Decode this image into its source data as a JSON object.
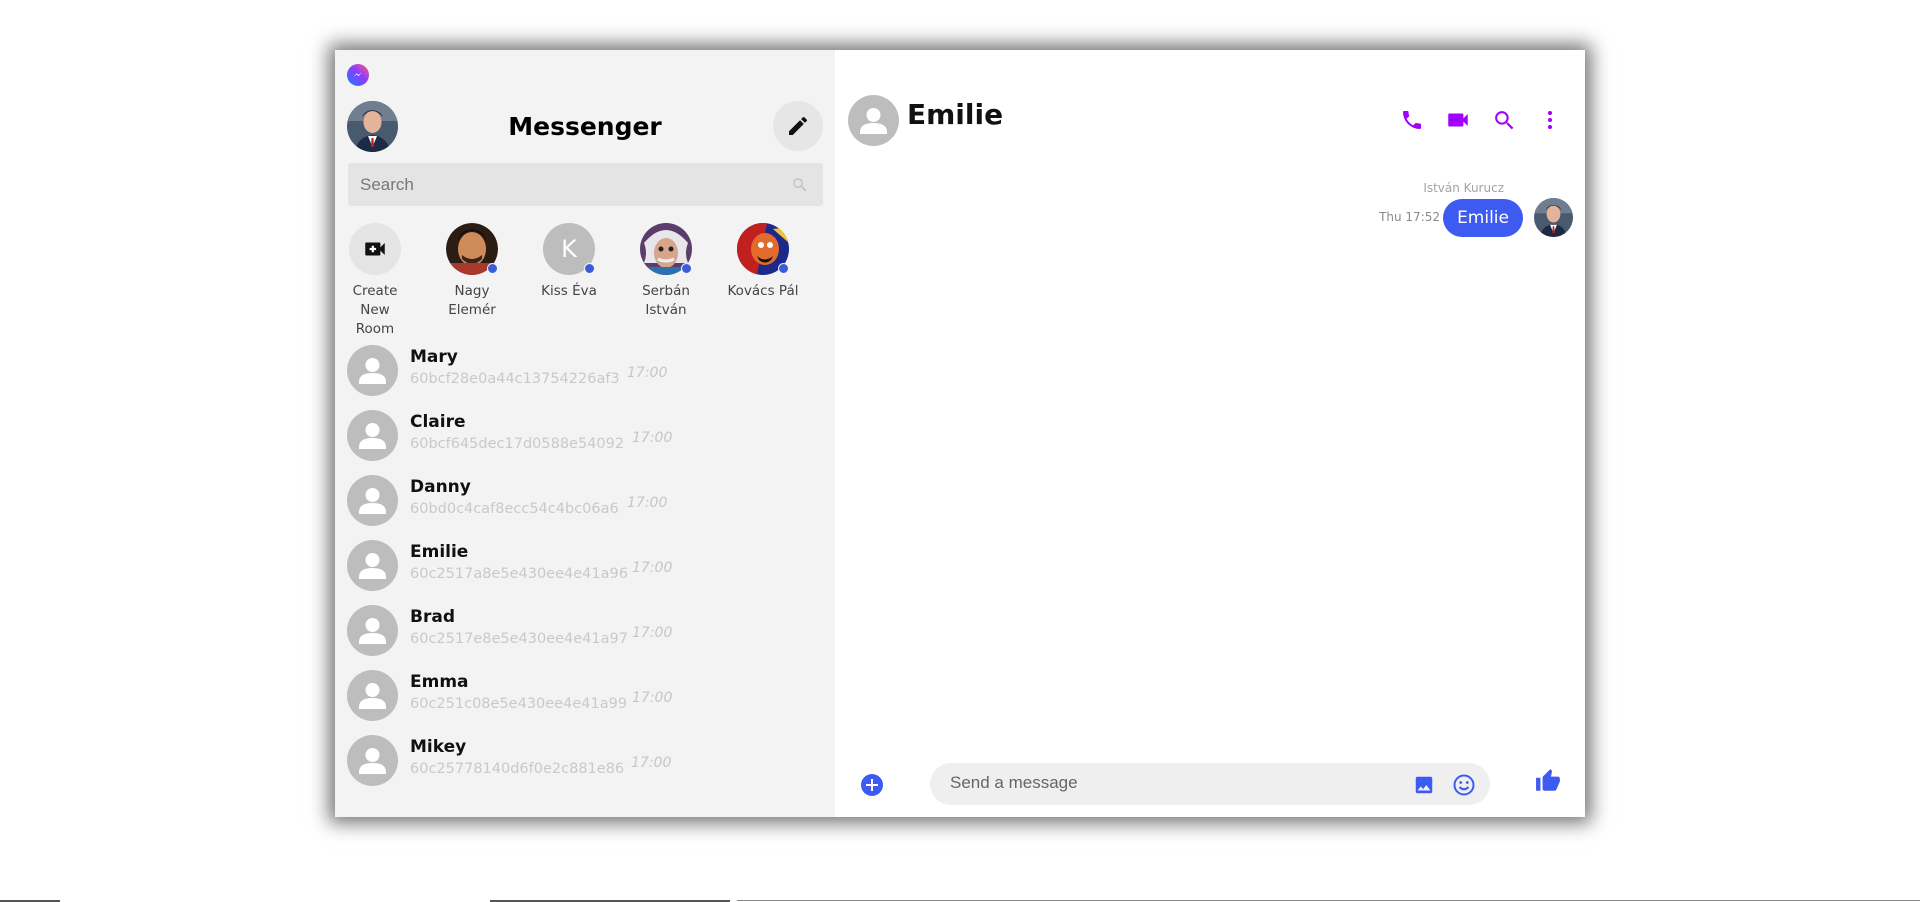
{
  "sidebar": {
    "title": "Messenger",
    "search_placeholder": "Search",
    "stories": [
      {
        "label": "Create New Room",
        "type": "create"
      },
      {
        "label": "Nagy Elemér",
        "online": true
      },
      {
        "label": "Kiss Éva",
        "initial": "K",
        "online": true
      },
      {
        "label": "Serbán István",
        "online": true
      },
      {
        "label": "Kovács Pál",
        "online": true
      }
    ],
    "conversations": [
      {
        "name": "Mary",
        "preview": "60bcf28e0a44c13754226af3",
        "time": "17:00"
      },
      {
        "name": "Claire",
        "preview": "60bcf645dec17d0588e54092",
        "time": "17:00"
      },
      {
        "name": "Danny",
        "preview": "60bd0c4caf8ecc54c4bc06a6",
        "time": "17:00"
      },
      {
        "name": "Emilie",
        "preview": "60c2517a8e5e430ee4e41a96",
        "time": "17:00"
      },
      {
        "name": "Brad",
        "preview": "60c2517e8e5e430ee4e41a97",
        "time": "17:00"
      },
      {
        "name": "Emma",
        "preview": "60c251c08e5e430ee4e41a99",
        "time": "17:00"
      },
      {
        "name": "Mikey",
        "preview": "60c25778140d6f0e2c881e86",
        "time": "17:00"
      }
    ]
  },
  "chat": {
    "contact_name": "Emilie",
    "messages": [
      {
        "sender": "István Kurucz",
        "time": "Thu 17:52",
        "text": "Emilie"
      }
    ],
    "composer_placeholder": "Send a message"
  },
  "icons": {
    "brand": "messenger-logo-icon",
    "compose": "pencil-icon",
    "search": "search-icon",
    "create_room": "video-plus-icon",
    "call": "phone-icon",
    "video": "video-camera-icon",
    "chat_search": "search-icon",
    "more": "more-vertical-icon",
    "plus": "plus-circle-icon",
    "image": "image-icon",
    "emoji": "emoji-icon",
    "like": "thumbs-up-icon"
  },
  "colors": {
    "accent_purple": "#a100ff",
    "accent_blue": "#3d5af1",
    "online": "#3b5bdb",
    "sidebar_bg": "#f3f3f3"
  }
}
